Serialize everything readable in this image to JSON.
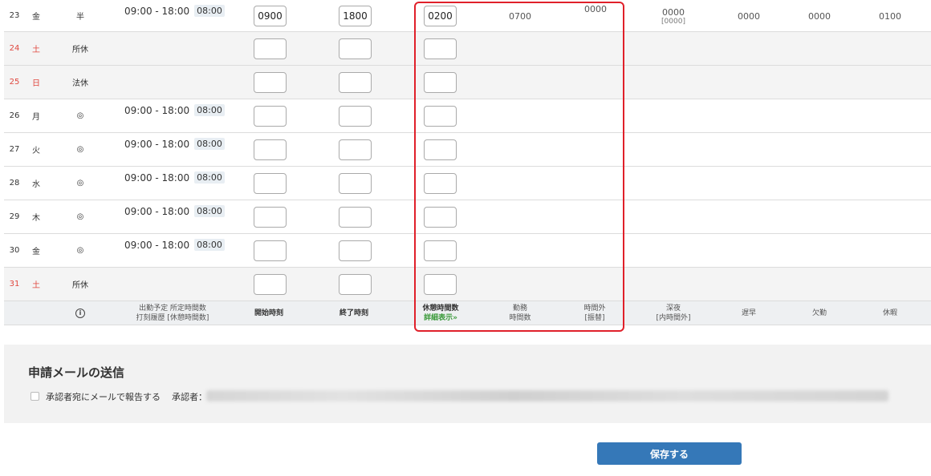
{
  "rows": [
    {
      "day": "23",
      "wd": "金",
      "type": "半",
      "time": "09:00 - 18:00",
      "hours": "08:00",
      "start": "0900",
      "end": "1800",
      "break": "0200",
      "holiday": false
    },
    {
      "day": "24",
      "wd": "土",
      "type": "所休",
      "time": "",
      "hours": "",
      "start": "",
      "end": "",
      "break": "",
      "holiday": true
    },
    {
      "day": "25",
      "wd": "日",
      "type": "法休",
      "time": "",
      "hours": "",
      "start": "",
      "end": "",
      "break": "",
      "holiday": true
    },
    {
      "day": "26",
      "wd": "月",
      "type": "◎",
      "time": "09:00 - 18:00",
      "hours": "08:00",
      "start": "",
      "end": "",
      "break": "",
      "holiday": false
    },
    {
      "day": "27",
      "wd": "火",
      "type": "◎",
      "time": "09:00 - 18:00",
      "hours": "08:00",
      "start": "",
      "end": "",
      "break": "",
      "holiday": false
    },
    {
      "day": "28",
      "wd": "水",
      "type": "◎",
      "time": "09:00 - 18:00",
      "hours": "08:00",
      "start": "",
      "end": "",
      "break": "",
      "holiday": false
    },
    {
      "day": "29",
      "wd": "木",
      "type": "◎",
      "time": "09:00 - 18:00",
      "hours": "08:00",
      "start": "",
      "end": "",
      "break": "",
      "holiday": false
    },
    {
      "day": "30",
      "wd": "金",
      "type": "◎",
      "time": "09:00 - 18:00",
      "hours": "08:00",
      "start": "",
      "end": "",
      "break": "",
      "holiday": false
    },
    {
      "day": "31",
      "wd": "土",
      "type": "所休",
      "time": "",
      "hours": "",
      "start": "",
      "end": "",
      "break": "",
      "holiday": true
    }
  ],
  "row23_totals": {
    "work": "0700",
    "overtime": "0000",
    "night": "0000",
    "night_sub": "[0000]",
    "late": "0000",
    "absence": "0000",
    "leave": "0100"
  },
  "footer": {
    "sched_line1": "出勤予定  所定時間数",
    "sched_line2": "打刻履歴 [休憩時間数]",
    "start": "開始時刻",
    "end": "終了時刻",
    "break": "休憩時間数",
    "detail": "詳細表示",
    "work1": "勤務",
    "work2": "時間数",
    "ot1": "時間外",
    "ot2": "[振替]",
    "night1": "深夜",
    "night2": "[内時間外]",
    "late": "遅早",
    "absence": "欠勤",
    "leave": "休暇"
  },
  "mail": {
    "title": "申請メールの送信",
    "checkbox_label": "承認者宛にメールで報告する",
    "approver_label": "承認者："
  },
  "save_label": "保存する",
  "colors": {
    "accent": "#3578b8",
    "highlight": "#e0202a",
    "holiday_red": "#e0483f",
    "detail_green": "#3b9a3b"
  }
}
